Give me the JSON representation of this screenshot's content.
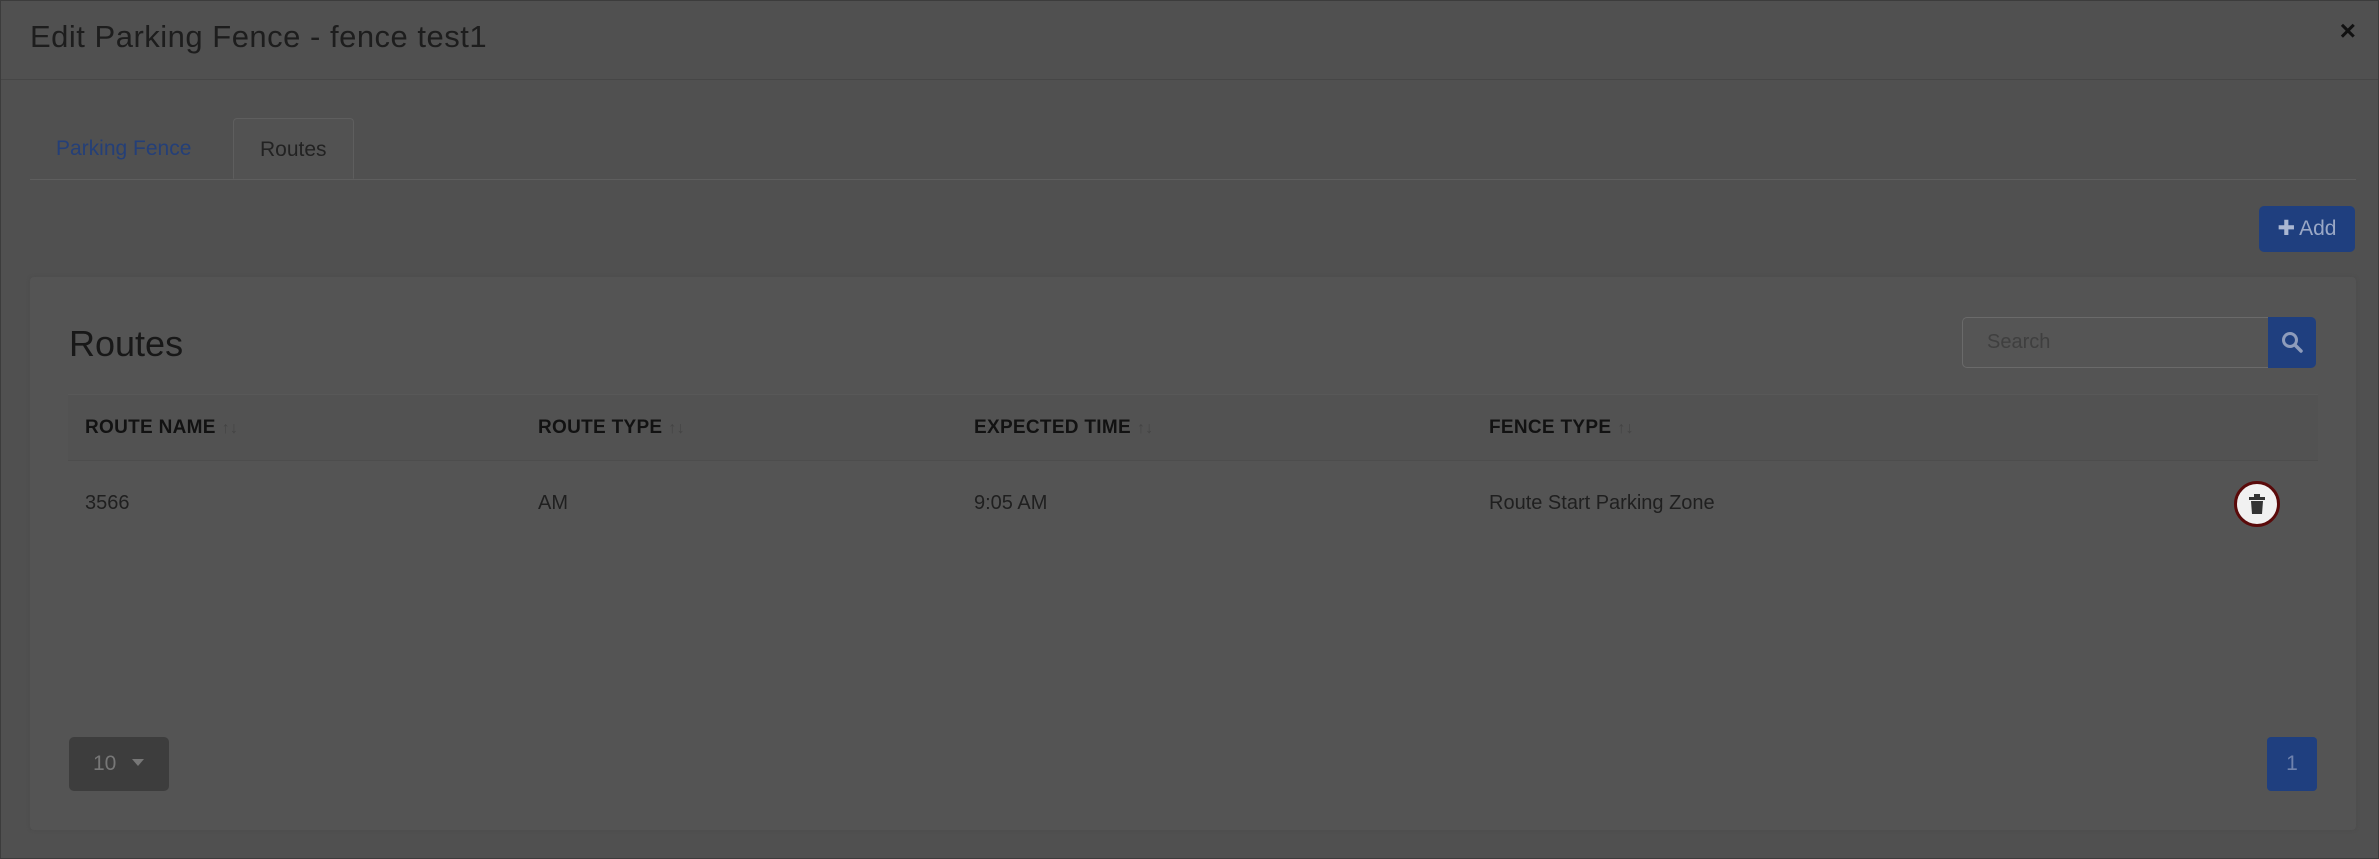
{
  "modal": {
    "title": "Edit Parking Fence - fence test1",
    "close_label": "×"
  },
  "tabs": [
    {
      "label": "Parking Fence",
      "active": false
    },
    {
      "label": "Routes",
      "active": true
    }
  ],
  "toolbar": {
    "add_label": "Add",
    "add_icon": "plus-icon"
  },
  "panel": {
    "title": "Routes",
    "search": {
      "placeholder": "Search",
      "value": ""
    }
  },
  "table": {
    "columns": [
      {
        "label": "ROUTE NAME",
        "sort_icon": "↑↓"
      },
      {
        "label": "ROUTE TYPE",
        "sort_icon": "↑↓"
      },
      {
        "label": "EXPECTED TIME",
        "sort_icon": "↑↓"
      },
      {
        "label": "FENCE TYPE",
        "sort_icon": "↑↓"
      }
    ],
    "rows": [
      {
        "route_name": "3566",
        "route_type": "AM",
        "expected_time": "9:05 AM",
        "fence_type": "Route Start Parking Zone",
        "action_icon": "trash-icon"
      }
    ]
  },
  "pagination": {
    "page_size": "10",
    "current_page": "1"
  },
  "colors": {
    "primary": "#1f3f7f",
    "delete_border": "#5a0a0a",
    "overlay": "#505050"
  }
}
